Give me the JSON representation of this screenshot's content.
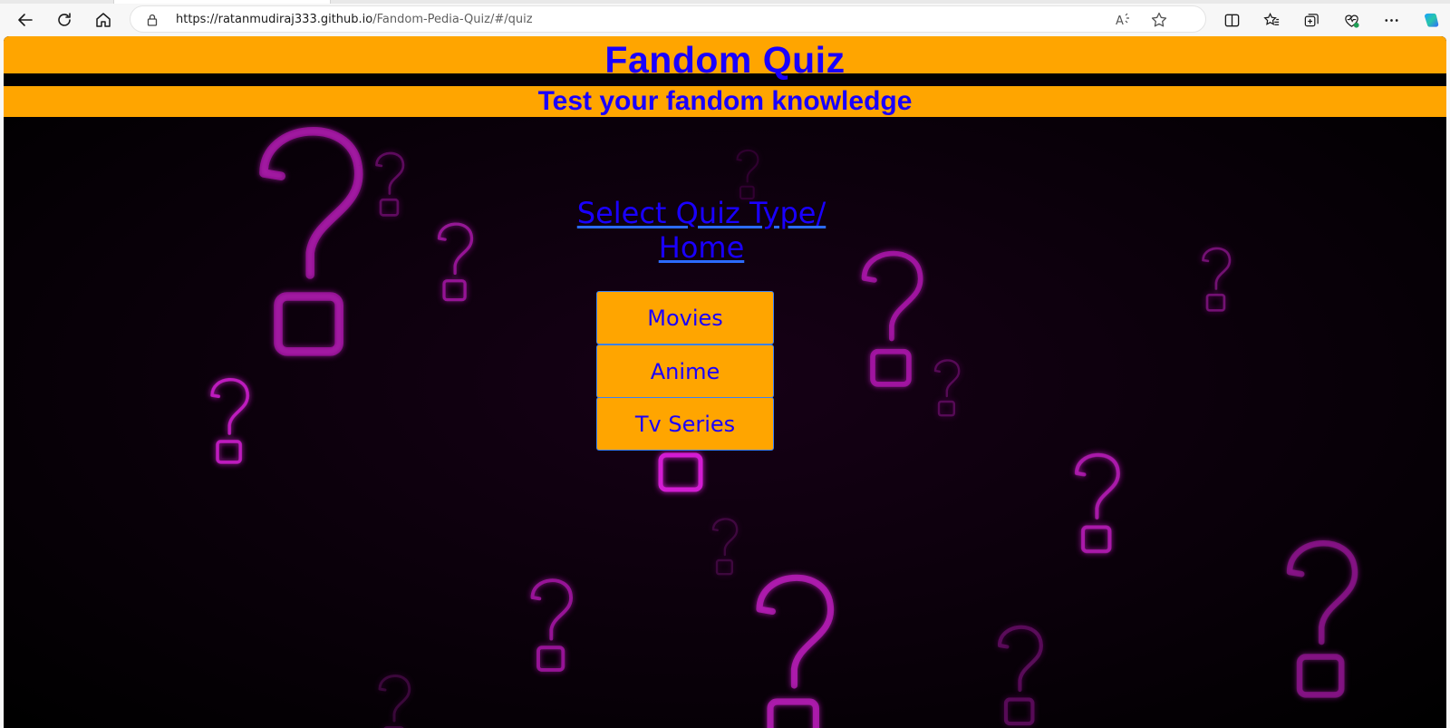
{
  "browser": {
    "url_host": "https://ratanmudiraj333.github.io",
    "url_path": "/Fandom-Pedia-Quiz/#/quiz",
    "icons": [
      "back-icon",
      "refresh-icon",
      "home-icon",
      "lock-icon",
      "read-aloud-icon",
      "favorite-star-icon",
      "split-screen-icon",
      "favorites-icon",
      "collections-icon",
      "browser-essentials-icon",
      "more-icon",
      "copilot-icon"
    ]
  },
  "header": {
    "title": "Fandom Quiz",
    "subtitle": "Test your fandom knowledge"
  },
  "main": {
    "select_link_line1": "Select Quiz Type/",
    "select_link_line2": "Home",
    "options": [
      {
        "label": "Movies"
      },
      {
        "label": "Anime"
      },
      {
        "label": "Tv Series"
      }
    ]
  },
  "colors": {
    "header_bg": "#ffa500",
    "header_text": "#1a00ff",
    "page_bg": "#000000",
    "neon_accent": "#d21fd2"
  }
}
